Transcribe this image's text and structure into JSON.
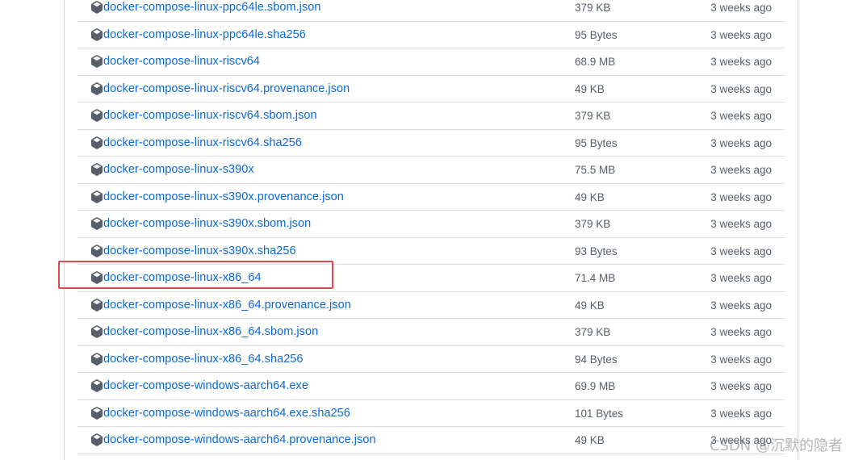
{
  "assets": [
    {
      "name": "docker-compose-linux-ppc64le.sbom.json",
      "size": "379 KB",
      "date": "3 weeks ago"
    },
    {
      "name": "docker-compose-linux-ppc64le.sha256",
      "size": "95 Bytes",
      "date": "3 weeks ago"
    },
    {
      "name": "docker-compose-linux-riscv64",
      "size": "68.9 MB",
      "date": "3 weeks ago"
    },
    {
      "name": "docker-compose-linux-riscv64.provenance.json",
      "size": "49 KB",
      "date": "3 weeks ago"
    },
    {
      "name": "docker-compose-linux-riscv64.sbom.json",
      "size": "379 KB",
      "date": "3 weeks ago"
    },
    {
      "name": "docker-compose-linux-riscv64.sha256",
      "size": "95 Bytes",
      "date": "3 weeks ago"
    },
    {
      "name": "docker-compose-linux-s390x",
      "size": "75.5 MB",
      "date": "3 weeks ago"
    },
    {
      "name": "docker-compose-linux-s390x.provenance.json",
      "size": "49 KB",
      "date": "3 weeks ago"
    },
    {
      "name": "docker-compose-linux-s390x.sbom.json",
      "size": "379 KB",
      "date": "3 weeks ago"
    },
    {
      "name": "docker-compose-linux-s390x.sha256",
      "size": "93 Bytes",
      "date": "3 weeks ago"
    },
    {
      "name": "docker-compose-linux-x86_64",
      "size": "71.4 MB",
      "date": "3 weeks ago",
      "highlighted": true
    },
    {
      "name": "docker-compose-linux-x86_64.provenance.json",
      "size": "49 KB",
      "date": "3 weeks ago"
    },
    {
      "name": "docker-compose-linux-x86_64.sbom.json",
      "size": "379 KB",
      "date": "3 weeks ago"
    },
    {
      "name": "docker-compose-linux-x86_64.sha256",
      "size": "94 Bytes",
      "date": "3 weeks ago"
    },
    {
      "name": "docker-compose-windows-aarch64.exe",
      "size": "69.9 MB",
      "date": "3 weeks ago"
    },
    {
      "name": "docker-compose-windows-aarch64.exe.sha256",
      "size": "101 Bytes",
      "date": "3 weeks ago"
    },
    {
      "name": "docker-compose-windows-aarch64.provenance.json",
      "size": "49 KB",
      "date": "3 weeks ago"
    }
  ],
  "icons": {
    "asset": "package-icon"
  },
  "colors": {
    "link": "#0969da",
    "muted": "#57606a",
    "highlight": "#e5484d"
  },
  "watermark": "CSDN @沉默的隐者"
}
